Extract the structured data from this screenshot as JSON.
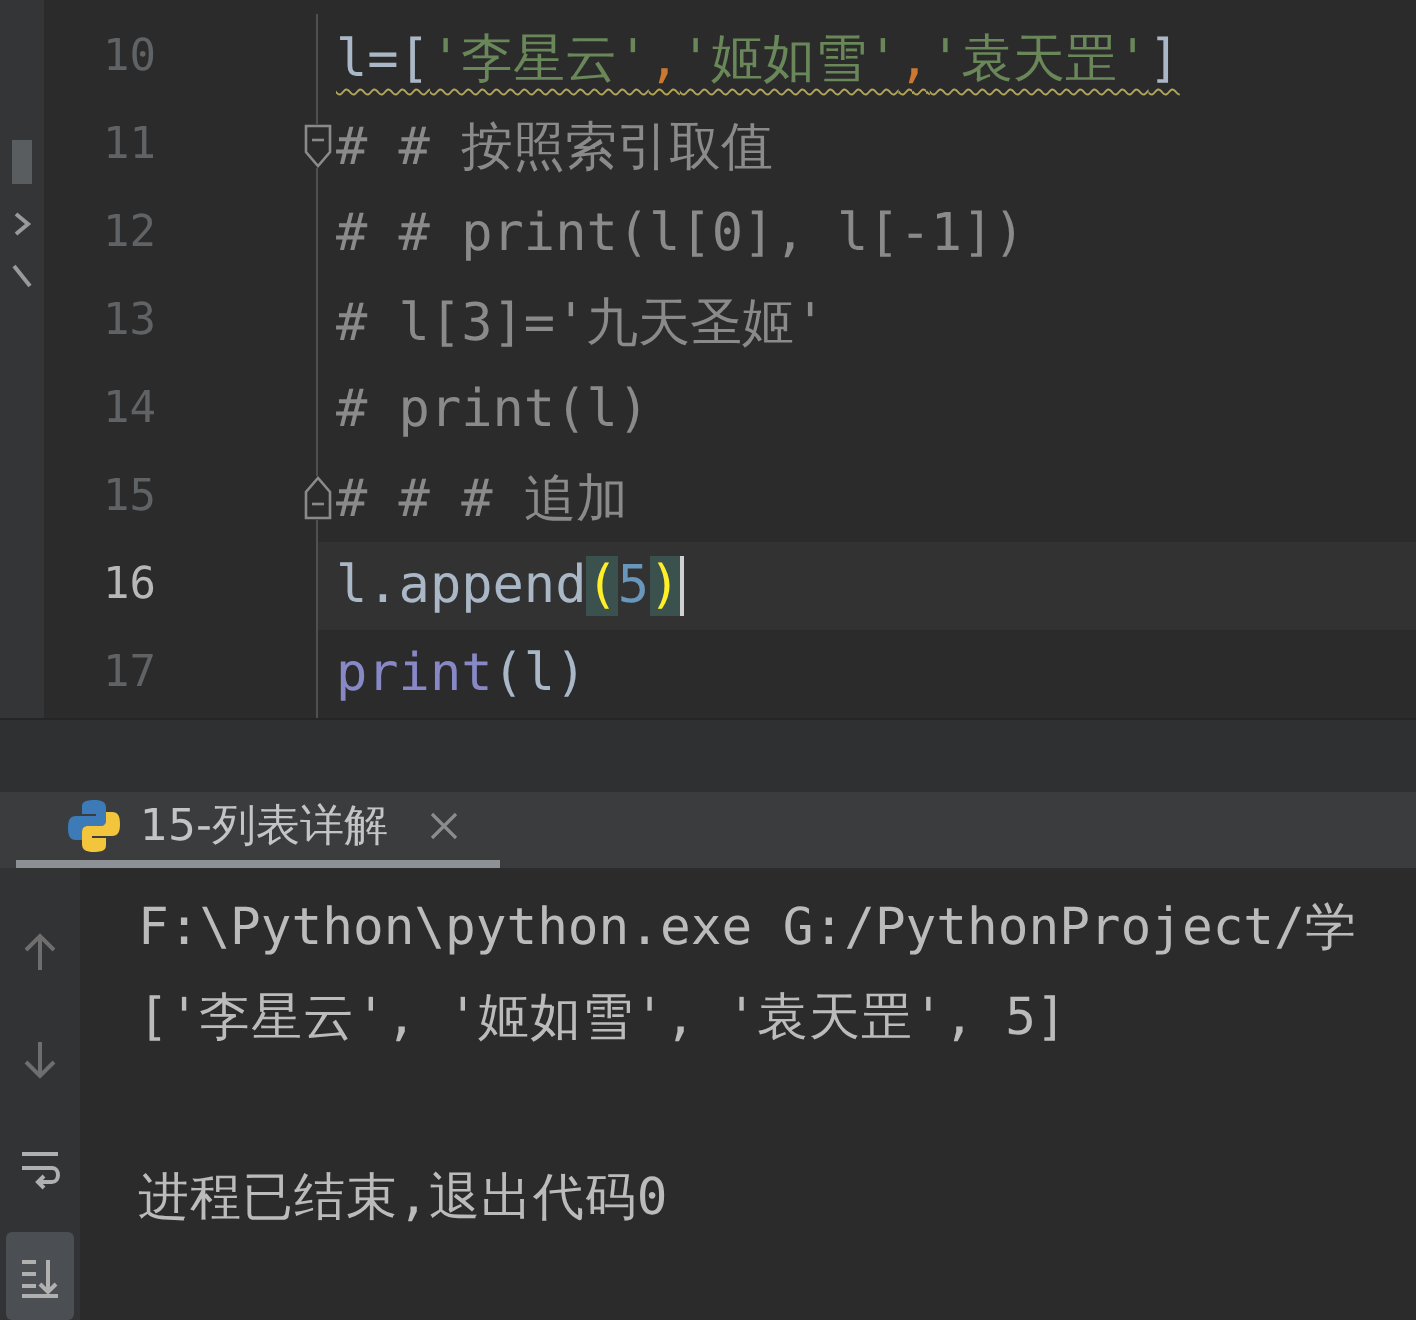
{
  "editor": {
    "lines": [
      {
        "number": "10",
        "current": false,
        "warning": true,
        "kind": "code",
        "tokens": [
          {
            "text": "l=[",
            "kind": "plain"
          },
          {
            "text": "'李星云'",
            "kind": "string"
          },
          {
            "text": ",",
            "kind": "punct"
          },
          {
            "text": "'姬如雪'",
            "kind": "string"
          },
          {
            "text": ",",
            "kind": "punct"
          },
          {
            "text": "'袁天罡'",
            "kind": "string"
          },
          {
            "text": "]",
            "kind": "plain"
          }
        ]
      },
      {
        "number": "11",
        "current": false,
        "warning": false,
        "kind": "fold-start",
        "tokens": [
          {
            "text": "# # 按照索引取值",
            "kind": "comment"
          }
        ]
      },
      {
        "number": "12",
        "current": false,
        "warning": false,
        "kind": "code",
        "tokens": [
          {
            "text": "# # print(l[0], l[-1])",
            "kind": "comment"
          }
        ]
      },
      {
        "number": "13",
        "current": false,
        "warning": false,
        "kind": "code",
        "tokens": [
          {
            "text": "# l[3]='九天圣姬'",
            "kind": "comment"
          }
        ]
      },
      {
        "number": "14",
        "current": false,
        "warning": false,
        "kind": "code",
        "tokens": [
          {
            "text": "# print(l)",
            "kind": "comment"
          }
        ]
      },
      {
        "number": "15",
        "current": false,
        "warning": false,
        "kind": "fold-end",
        "tokens": [
          {
            "text": "# # # 追加",
            "kind": "comment"
          }
        ]
      },
      {
        "number": "16",
        "current": true,
        "warning": false,
        "kind": "code",
        "tokens": [
          {
            "text": "l.append",
            "kind": "plain"
          },
          {
            "text": "(",
            "kind": "brace"
          },
          {
            "text": "5",
            "kind": "number"
          },
          {
            "text": ")",
            "kind": "brace"
          }
        ]
      },
      {
        "number": "17",
        "current": false,
        "warning": false,
        "kind": "code",
        "tokens": [
          {
            "text": "print",
            "kind": "builtin"
          },
          {
            "text": "(l)",
            "kind": "plain"
          }
        ]
      }
    ]
  },
  "run_tabs": [
    {
      "label": "15-列表详解",
      "selected": true
    }
  ],
  "console": {
    "lines": [
      {
        "kind": "text",
        "text": "F:\\Python\\python.exe G:/PythonProject/学"
      },
      {
        "kind": "text",
        "text": "['李星云', '姬如雪', '袁天罡', 5]"
      },
      {
        "kind": "blank"
      },
      {
        "kind": "text",
        "text": "进程已结束,退出代码0"
      }
    ],
    "tools": [
      {
        "kind": "up",
        "selected": false
      },
      {
        "kind": "down",
        "selected": false
      },
      {
        "kind": "wrap",
        "selected": false
      },
      {
        "kind": "scroll-end",
        "selected": true
      }
    ]
  }
}
